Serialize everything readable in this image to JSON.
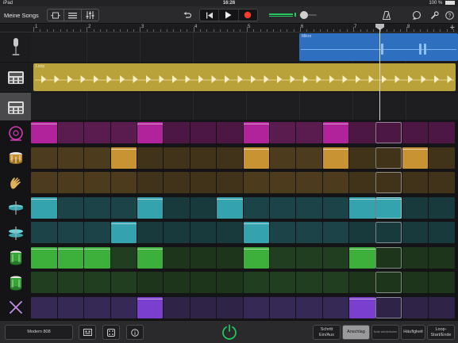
{
  "status": {
    "device": "iPad",
    "time": "16:26",
    "battery": "100 %"
  },
  "toolbar": {
    "title": "Meine Songs",
    "undo_icon": "undo-icon",
    "accent": "#22c55e",
    "record_color": "#ff3b30"
  },
  "ruler": {
    "bars": [
      "1",
      "2",
      "3",
      "4",
      "5",
      "6",
      "7",
      "8"
    ],
    "add_label": "+"
  },
  "tracks": [
    {
      "name": "microphone",
      "icon": "microphone-icon",
      "region": {
        "name": "Mikro",
        "color": "#2f6fc0"
      }
    },
    {
      "name": "beat-sequencer-1",
      "icon": "drum-machine-icon",
      "region": {
        "name": "Loop",
        "color": "#b9a23a"
      }
    },
    {
      "name": "beat-sequencer-2",
      "icon": "drum-machine-icon",
      "selected": true
    }
  ],
  "drum_rows": [
    {
      "name": "kick",
      "icon": "kick-drum-icon",
      "color": "#b0239a",
      "dim": "#5a1c4f",
      "steps": [
        1,
        0,
        0,
        0,
        1,
        0,
        0,
        0,
        1,
        0,
        0,
        1,
        0,
        0,
        0,
        0
      ]
    },
    {
      "name": "snare",
      "icon": "snare-drum-icon",
      "color": "#c89433",
      "dim": "#4d3b1e",
      "steps": [
        0,
        0,
        0,
        1,
        0,
        0,
        0,
        0,
        1,
        0,
        0,
        1,
        0,
        0,
        1,
        0
      ]
    },
    {
      "name": "clap",
      "icon": "clap-icon",
      "color": "#c89433",
      "dim": "#4d3b1e",
      "steps": [
        0,
        0,
        0,
        0,
        0,
        0,
        0,
        0,
        0,
        0,
        0,
        0,
        0,
        0,
        0,
        0
      ]
    },
    {
      "name": "hihat-closed",
      "icon": "hihat-closed-icon",
      "color": "#34a3ad",
      "dim": "#1c4448",
      "steps": [
        1,
        0,
        0,
        0,
        1,
        0,
        0,
        1,
        0,
        0,
        0,
        0,
        1,
        1,
        0,
        0
      ]
    },
    {
      "name": "hihat-open",
      "icon": "hihat-open-icon",
      "color": "#34a3ad",
      "dim": "#1c4448",
      "steps": [
        0,
        0,
        0,
        1,
        0,
        0,
        0,
        0,
        1,
        0,
        0,
        0,
        0,
        0,
        0,
        0
      ]
    },
    {
      "name": "tom-low",
      "icon": "tom-drum-icon",
      "color": "#3db03b",
      "dim": "#213e20",
      "steps": [
        1,
        1,
        1,
        0,
        1,
        0,
        0,
        0,
        1,
        0,
        0,
        0,
        1,
        0,
        0,
        0
      ]
    },
    {
      "name": "tom-high",
      "icon": "tom-drum-icon",
      "color": "#3db03b",
      "dim": "#213e20",
      "steps": [
        0,
        0,
        0,
        0,
        0,
        0,
        0,
        0,
        0,
        0,
        0,
        0,
        0,
        0,
        0,
        0
      ]
    },
    {
      "name": "sticks",
      "icon": "drumsticks-icon",
      "color": "#7b3fcf",
      "dim": "#372955",
      "steps": [
        0,
        0,
        0,
        0,
        1,
        0,
        0,
        0,
        0,
        0,
        0,
        0,
        1,
        0,
        0,
        0
      ]
    }
  ],
  "bottom": {
    "kit_name": "Modern 808",
    "step_label_1": "Schritt",
    "step_label_2": "Ein/Aus",
    "velocity_label": "Anschlag",
    "note_repeat_label": "Note wiederholen",
    "chance_label": "Häufigkeit",
    "loop_label_1": "Loop-",
    "loop_label_2": "Start/Ende"
  }
}
